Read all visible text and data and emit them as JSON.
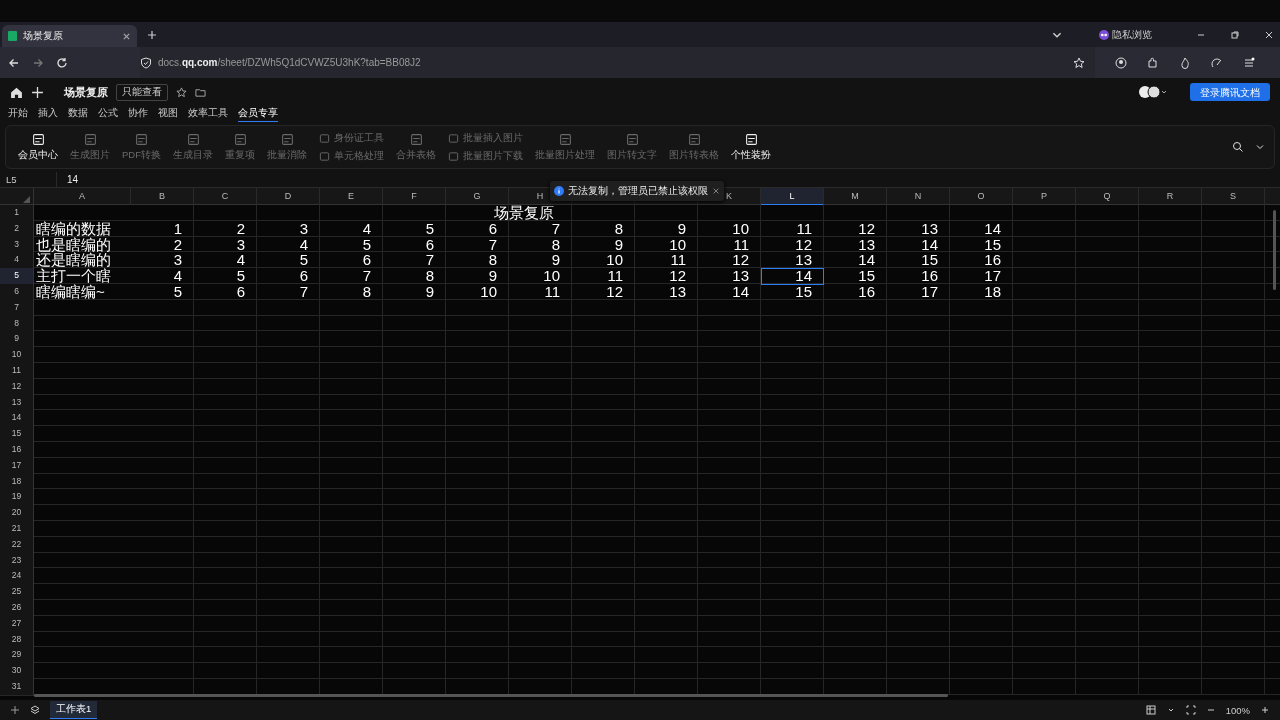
{
  "browser": {
    "tabs": [
      {
        "title": "场景复原",
        "selected": true
      }
    ],
    "private_label": "隐私浏览",
    "url": "docs.**qq.com**/sheet/DZWh5Q1dCVWZ5U3hK?tab=BB08J2"
  },
  "header": {
    "title": "场景复原",
    "mode_badge": "只能查看",
    "login_button": "登录腾讯文档"
  },
  "menu": [
    {
      "label": "开始",
      "selected": false
    },
    {
      "label": "插入",
      "selected": false
    },
    {
      "label": "数据",
      "selected": false
    },
    {
      "label": "公式",
      "selected": false
    },
    {
      "label": "协作",
      "selected": false
    },
    {
      "label": "视图",
      "selected": false
    },
    {
      "label": "效率工具",
      "selected": false
    },
    {
      "label": "会员专享",
      "selected": true
    }
  ],
  "ribbon": [
    {
      "kind": "large",
      "label": "会员中心",
      "disabled": false
    },
    {
      "kind": "large",
      "label": "生成图片",
      "disabled": true
    },
    {
      "kind": "large",
      "label": "PDF转换",
      "disabled": true
    },
    {
      "kind": "large",
      "label": "生成目录",
      "disabled": true
    },
    {
      "kind": "large",
      "label": "重复项",
      "disabled": true
    },
    {
      "kind": "large",
      "label": "批量消除",
      "disabled": true
    },
    {
      "kind": "small",
      "items": [
        {
          "label": "身份证工具",
          "disabled": true
        },
        {
          "label": "单元格处理",
          "disabled": true
        }
      ]
    },
    {
      "kind": "large",
      "label": "合并表格",
      "disabled": true
    },
    {
      "kind": "small",
      "items": [
        {
          "label": "批量插入图片",
          "disabled": true
        },
        {
          "label": "批量图片下载",
          "disabled": true
        }
      ]
    },
    {
      "kind": "large",
      "label": "批量图片处理",
      "disabled": true
    },
    {
      "kind": "large",
      "label": "图片转文字",
      "disabled": true
    },
    {
      "kind": "large",
      "label": "图片转表格",
      "disabled": true
    },
    {
      "kind": "large",
      "label": "个性装扮",
      "disabled": false
    }
  ],
  "formula_bar": {
    "cell": "L5",
    "value": "14"
  },
  "toast": "无法复制，管理员已禁止该权限",
  "sheet": {
    "columns": [
      {
        "label": "A",
        "selected": false
      },
      {
        "label": "B",
        "selected": false
      },
      {
        "label": "C",
        "selected": false
      },
      {
        "label": "D",
        "selected": false
      },
      {
        "label": "E",
        "selected": false
      },
      {
        "label": "F",
        "selected": false
      },
      {
        "label": "G",
        "selected": false
      },
      {
        "label": "H",
        "selected": false
      },
      {},
      {},
      {
        "label": "K",
        "selected": false
      },
      {
        "label": "L",
        "selected": true
      },
      {
        "label": "M",
        "selected": false
      },
      {
        "label": "N",
        "selected": false
      },
      {
        "label": "O",
        "selected": false
      },
      {
        "label": "P",
        "selected": false
      },
      {
        "label": "Q",
        "selected": false
      },
      {
        "label": "R",
        "selected": false
      },
      {
        "label": "S",
        "selected": false
      }
    ],
    "rows": [
      {
        "label": "1",
        "selected": false,
        "title": "场景复原"
      },
      {
        "label": "2",
        "selected": false,
        "cells": [
          "瞎编的数据",
          "1",
          "2",
          "3",
          "4",
          "5",
          "6",
          "7",
          "8",
          "9",
          "10",
          "11",
          "12",
          "13",
          "14"
        ]
      },
      {
        "label": "3",
        "selected": false,
        "cells": [
          "也是瞎编的",
          "2",
          "3",
          "4",
          "5",
          "6",
          "7",
          "8",
          "9",
          "10",
          "11",
          "12",
          "13",
          "14",
          "15"
        ]
      },
      {
        "label": "4",
        "selected": false,
        "cells": [
          "还是瞎编的",
          "3",
          "4",
          "5",
          "6",
          "7",
          "8",
          "9",
          "10",
          "11",
          "12",
          "13",
          "14",
          "15",
          "16"
        ]
      },
      {
        "label": "5",
        "selected": true,
        "cells": [
          "主打一个瞎",
          "4",
          "5",
          "6",
          "7",
          "8",
          "9",
          "10",
          "11",
          "12",
          "13",
          "14",
          "15",
          "16",
          "17"
        ]
      },
      {
        "label": "6",
        "selected": false,
        "cells": [
          "瞎编瞎编~",
          "5",
          "6",
          "7",
          "8",
          "9",
          "10",
          "11",
          "12",
          "13",
          "14",
          "15",
          "16",
          "17",
          "18"
        ]
      },
      {
        "label": "7",
        "selected": false
      },
      {
        "label": "8",
        "selected": false
      },
      {
        "label": "9",
        "selected": false
      },
      {
        "label": "10",
        "selected": false
      },
      {
        "label": "11",
        "selected": false
      },
      {
        "label": "12",
        "selected": false
      },
      {
        "label": "13",
        "selected": false
      },
      {
        "label": "14",
        "selected": false
      },
      {
        "label": "15",
        "selected": false
      },
      {
        "label": "16",
        "selected": false
      },
      {
        "label": "17",
        "selected": false
      },
      {
        "label": "18",
        "selected": false
      },
      {
        "label": "19",
        "selected": false
      },
      {
        "label": "20",
        "selected": false
      },
      {
        "label": "21",
        "selected": false
      },
      {
        "label": "22",
        "selected": false
      },
      {
        "label": "23",
        "selected": false
      },
      {
        "label": "24",
        "selected": false
      },
      {
        "label": "25",
        "selected": false
      },
      {
        "label": "26",
        "selected": false
      },
      {
        "label": "27",
        "selected": false
      },
      {
        "label": "28",
        "selected": false
      },
      {
        "label": "29",
        "selected": false
      },
      {
        "label": "30",
        "selected": false
      },
      {
        "label": "31",
        "selected": false
      }
    ]
  },
  "sheet_tabs": [
    {
      "label": "工作表1",
      "selected": true
    }
  ],
  "zoom": "100%"
}
